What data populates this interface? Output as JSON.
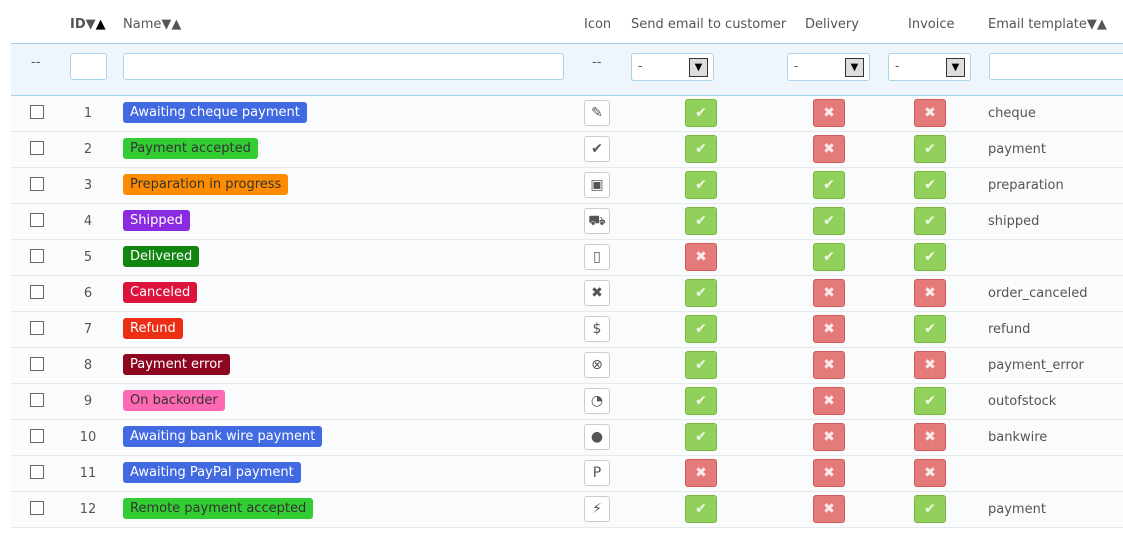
{
  "headers": {
    "id": "ID",
    "name": "Name",
    "icon": "Icon",
    "send_email": "Send email to customer",
    "delivery": "Delivery",
    "invoice": "Invoice",
    "template": "Email template",
    "sort_down": "▼",
    "sort_up": "▲"
  },
  "filters": {
    "bulk": "--",
    "icon": "--",
    "send_email": "-",
    "delivery": "-",
    "invoice": "-",
    "id": "",
    "name": "",
    "template": ""
  },
  "colors": {
    "ok": "#92d05c",
    "no": "#e47a7a"
  },
  "rows": [
    {
      "id": "1",
      "name": "Awaiting cheque payment",
      "color": "#4169e1",
      "text": "#fff",
      "icon": "✎",
      "icon_name": "cheque-icon",
      "send": true,
      "delivery": false,
      "invoice": false,
      "template": "cheque"
    },
    {
      "id": "2",
      "name": "Payment accepted",
      "color": "#32cd32",
      "text": "#333",
      "icon": "✔",
      "icon_name": "check-icon",
      "send": true,
      "delivery": false,
      "invoice": true,
      "template": "payment"
    },
    {
      "id": "3",
      "name": "Preparation in progress",
      "color": "#ff8c00",
      "text": "#333",
      "icon": "▣",
      "icon_name": "package-icon",
      "send": true,
      "delivery": true,
      "invoice": true,
      "template": "preparation"
    },
    {
      "id": "4",
      "name": "Shipped",
      "color": "#8a2be2",
      "text": "#fff",
      "icon": "⛟",
      "icon_name": "truck-icon",
      "send": true,
      "delivery": true,
      "invoice": true,
      "template": "shipped"
    },
    {
      "id": "5",
      "name": "Delivered",
      "color": "#108510",
      "text": "#fff",
      "icon": "▯",
      "icon_name": "door-icon",
      "send": false,
      "delivery": true,
      "invoice": true,
      "template": ""
    },
    {
      "id": "6",
      "name": "Canceled",
      "color": "#dc143c",
      "text": "#fff",
      "icon": "✖",
      "icon_name": "cross-icon",
      "send": true,
      "delivery": false,
      "invoice": false,
      "template": "order_canceled"
    },
    {
      "id": "7",
      "name": "Refund",
      "color": "#ec2e15",
      "text": "#fff",
      "icon": "$",
      "icon_name": "money-icon",
      "send": true,
      "delivery": false,
      "invoice": true,
      "template": "refund"
    },
    {
      "id": "8",
      "name": "Payment error",
      "color": "#8f0621",
      "text": "#fff",
      "icon": "⊗",
      "icon_name": "error-icon",
      "send": true,
      "delivery": false,
      "invoice": false,
      "template": "payment_error"
    },
    {
      "id": "9",
      "name": "On backorder",
      "color": "#ff69b4",
      "text": "#333",
      "icon": "◔",
      "icon_name": "clock-icon",
      "send": true,
      "delivery": false,
      "invoice": true,
      "template": "outofstock"
    },
    {
      "id": "10",
      "name": "Awaiting bank wire payment",
      "color": "#4169e1",
      "text": "#fff",
      "icon": "●",
      "icon_name": "coins-icon",
      "send": true,
      "delivery": false,
      "invoice": false,
      "template": "bankwire"
    },
    {
      "id": "11",
      "name": "Awaiting PayPal payment",
      "color": "#4169e1",
      "text": "#fff",
      "icon": "P",
      "icon_name": "paypal-icon",
      "send": false,
      "delivery": false,
      "invoice": false,
      "template": ""
    },
    {
      "id": "12",
      "name": "Remote payment accepted",
      "color": "#32cd32",
      "text": "#333",
      "icon": "⚡",
      "icon_name": "plug-icon",
      "send": true,
      "delivery": false,
      "invoice": true,
      "template": "payment"
    }
  ]
}
